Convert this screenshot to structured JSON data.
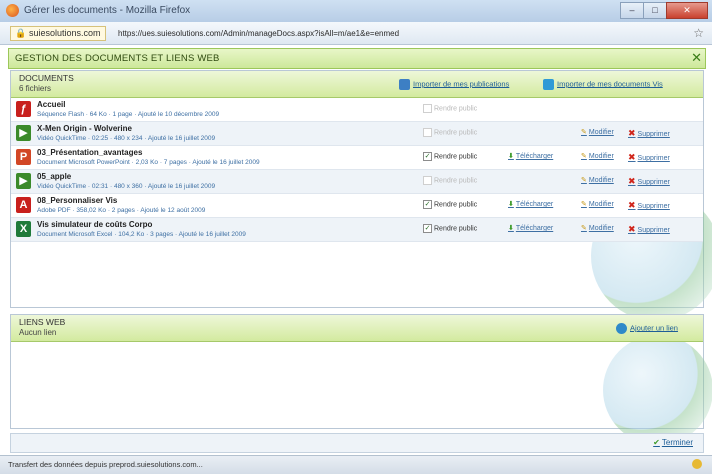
{
  "window": {
    "title": "Gérer les documents - Mozilla Firefox",
    "minimize": "–",
    "maximize": "□",
    "close": "✕"
  },
  "urlbar": {
    "site": "suiesolutions.com",
    "url": "https://ues.suiesolutions.com/Admin/manageDocs.aspx?isAll=m/ae1&e=enmed",
    "bookmark_icon": "star-icon"
  },
  "modal": {
    "title": "GESTION DES DOCUMENTS ET LIENS WEB",
    "close": "✕"
  },
  "documents_panel": {
    "heading": "DOCUMENTS",
    "count": "6 fichiers",
    "import_pub": "Importer de mes publications",
    "import_docs": "Importer de mes documents Vis",
    "items": [
      {
        "name": "Accueil",
        "meta": "Séquence Flash · 64 Ko · 1 page · Ajouté le 10 décembre 2009",
        "public_label": "Rendre public",
        "public_checked": false,
        "disabled": true,
        "download": "",
        "edit": "",
        "delete": "",
        "icon": "flash-icon",
        "icon_color": "#c8201d"
      },
      {
        "name": "X-Men Origin - Wolverine",
        "meta": "Vidéo QuickTime · 02:25 · 480 x 234 · Ajouté le 16 juillet 2009",
        "public_label": "Rendre public",
        "public_checked": false,
        "disabled": true,
        "download": "",
        "edit": "Modifier",
        "delete": "Supprimer",
        "icon": "video-icon",
        "icon_color": "#3b8a2a"
      },
      {
        "name": "03_Présentation_avantages",
        "meta": "Document Microsoft PowerPoint · 2,03 Ko · 7 pages · Ajouté le 16 juillet 2009",
        "public_label": "Rendre public",
        "public_checked": true,
        "disabled": false,
        "download": "Télécharger",
        "edit": "Modifier",
        "delete": "Supprimer",
        "icon": "powerpoint-icon",
        "icon_color": "#d24726"
      },
      {
        "name": "05_apple",
        "meta": "Vidéo QuickTime · 02:31 · 480 x 360 · Ajouté le 16 juillet 2009",
        "public_label": "Rendre public",
        "public_checked": false,
        "disabled": true,
        "download": "",
        "edit": "Modifier",
        "delete": "Supprimer",
        "icon": "video-icon",
        "icon_color": "#3b8a2a"
      },
      {
        "name": "08_Personnaliser Vis",
        "meta": "Adobe PDF · 358,02 Ko · 2 pages · Ajouté le 12 août 2009",
        "public_label": "Rendre public",
        "public_checked": true,
        "disabled": false,
        "download": "Télécharger",
        "edit": "Modifier",
        "delete": "Supprimer",
        "icon": "pdf-icon",
        "icon_color": "#c8201d"
      },
      {
        "name": "Vis simulateur de coûts Corpo",
        "meta": "Document Microsoft Excel · 104,2 Ko · 3 pages · Ajouté le 16 juillet 2009",
        "public_label": "Rendre public",
        "public_checked": true,
        "disabled": false,
        "download": "Télécharger",
        "edit": "Modifier",
        "delete": "Supprimer",
        "icon": "excel-icon",
        "icon_color": "#1f7a3a"
      }
    ]
  },
  "links_panel": {
    "heading": "LIENS WEB",
    "count": "Aucun lien",
    "add": "Ajouter un lien"
  },
  "footer": {
    "finish": "Terminer"
  },
  "status": {
    "text": "Transfert des données depuis preprod.suiesolutions.com..."
  }
}
